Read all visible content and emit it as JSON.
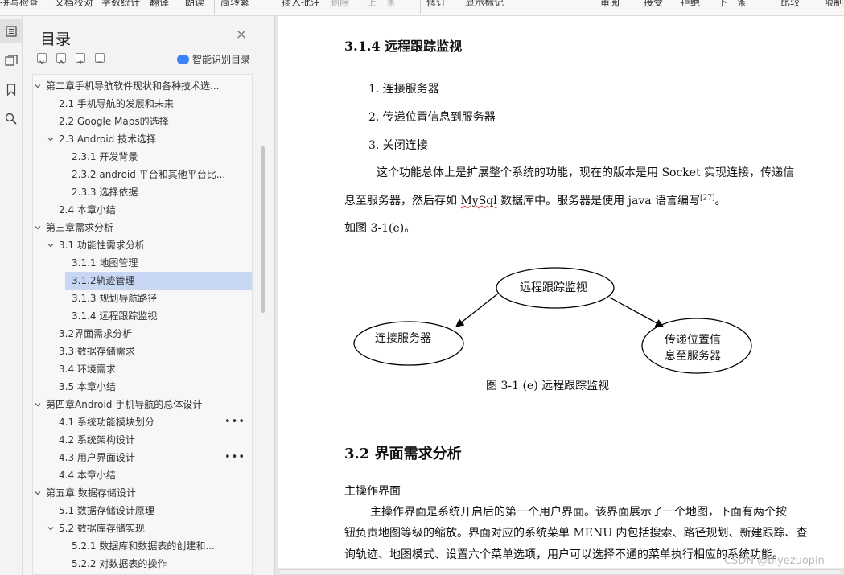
{
  "toolbar": {
    "items": [
      "拼写检查",
      "文档校对",
      "字数统计",
      "翻译",
      "朗读",
      "简转繁",
      "插入批注",
      "删除",
      "上一条",
      "修订",
      "显示标记",
      "审阅",
      "接受",
      "拒绝",
      "下一条",
      "比较",
      "限制"
    ]
  },
  "toc": {
    "title": "目录",
    "smart_label": "智能识别目录",
    "items": [
      {
        "label": "第二章手机导航软件现状和各种技术选...",
        "level": 0,
        "expanded": true
      },
      {
        "label": "2.1 手机导航的发展和未来",
        "level": 1
      },
      {
        "label": "2.2 Google Maps的选择",
        "level": 1
      },
      {
        "label": "2.3 Android  技术选择",
        "level": 1,
        "expanded": true
      },
      {
        "label": "2.3.1 开发背景",
        "level": 2
      },
      {
        "label": "2.3.2 android 平台和其他平台比...",
        "level": 2
      },
      {
        "label": "2.3.3  选择依据",
        "level": 2
      },
      {
        "label": "2.4  本章小结",
        "level": 1
      },
      {
        "label": "第三章需求分析",
        "level": 0,
        "expanded": true
      },
      {
        "label": "3.1  功能性需求分析",
        "level": 1,
        "expanded": true
      },
      {
        "label": "3.1.1  地图管理",
        "level": 2
      },
      {
        "label": "3.1.2轨迹管理",
        "level": 2,
        "selected": true
      },
      {
        "label": "3.1.3  规划导航路径",
        "level": 2
      },
      {
        "label": "3.1.4 远程跟踪监视",
        "level": 2
      },
      {
        "label": "3.2界面需求分析",
        "level": 1
      },
      {
        "label": "3.3 数据存储需求",
        "level": 1
      },
      {
        "label": "3.4  环境需求",
        "level": 1
      },
      {
        "label": "3.5 本章小结",
        "level": 1
      },
      {
        "label": "第四章Android 手机导航的总体设计",
        "level": 0,
        "expanded": true
      },
      {
        "label": "4.1  系统功能模块划分",
        "level": 1,
        "more": true
      },
      {
        "label": "4.2  系统架构设计",
        "level": 1
      },
      {
        "label": "4.3 用户界面设计",
        "level": 1,
        "more": true
      },
      {
        "label": "4.4  本章小结",
        "level": 1
      },
      {
        "label": "第五章  数据存储设计",
        "level": 0,
        "expanded": true
      },
      {
        "label": "5.1 数据存储设计原理",
        "level": 1
      },
      {
        "label": "5.2 数据库存储实现",
        "level": 1,
        "expanded": true
      },
      {
        "label": "5.2.1  数据库和数据表的创建和...",
        "level": 2
      },
      {
        "label": "5.2.2  对数据表的操作",
        "level": 2
      }
    ]
  },
  "doc": {
    "h314": "3.1.4 远程跟踪监视",
    "list": [
      "1.  连接服务器",
      "2.  传递位置信息到服务器",
      "3.  关闭连接"
    ],
    "para1a": "这个功能总体上是扩展整个系统的功能，现在的版本是用 Socket 实现连接，传递信",
    "para1b_pre": "息至服务器，然后存如 ",
    "para1b_mysql": "MySql",
    "para1b_post": " 数据库中。服务器是使用 java 语言编写",
    "para1b_ref": "[27]",
    "para1b_end": "。",
    "para1c": "如图 3-1(e)。",
    "diagram": {
      "center": "远程跟踪监视",
      "left": "连接服务器",
      "right_line1": "传递位置信",
      "right_line2": "息至服务器",
      "caption": "图 3-1 (e)  远程跟踪监视"
    },
    "h32": "3.2  界面需求分析",
    "sub": "主操作界面",
    "para2a": "主操作界面是系统开启后的第一个用户界面。该界面展示了一个地图，下面有两个按",
    "para2b": "钮负责地图等级的缩放。界面对应的系统菜单 MENU 内包括搜索、路径规划、新建跟踪、查",
    "para2c": "询轨迹、地图模式、设置六个菜单选项，用户可以选择不通的菜单执行相应的系统功能。"
  },
  "watermark": "CSDN @biyezuopin"
}
